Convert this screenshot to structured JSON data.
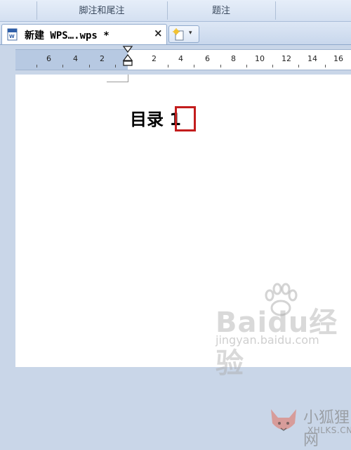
{
  "ribbon": {
    "groups": [
      {
        "label": "脚注和尾注"
      },
      {
        "label": "题注"
      }
    ]
  },
  "tab_bar": {
    "document_tab": {
      "title": "新建 WPS….wps *",
      "close_label": "×"
    },
    "new_tab_button": {
      "dropdown_label": "▾"
    }
  },
  "ruler": {
    "labels": [
      "6",
      "4",
      "2",
      "2",
      "4",
      "6",
      "8",
      "10",
      "12",
      "14",
      "16"
    ]
  },
  "document": {
    "heading": "目录 1"
  },
  "watermarks": {
    "baidu": "Baidu经验",
    "jingyan": "jingyan.baidu.com",
    "xhlks_cn": "小狐狸网",
    "xhlks_url": "XHLKS.CN"
  },
  "colors": {
    "highlight_border": "#c31d1d",
    "ruler_shade": "#b7c9e2",
    "background": "#c9d6e8"
  }
}
